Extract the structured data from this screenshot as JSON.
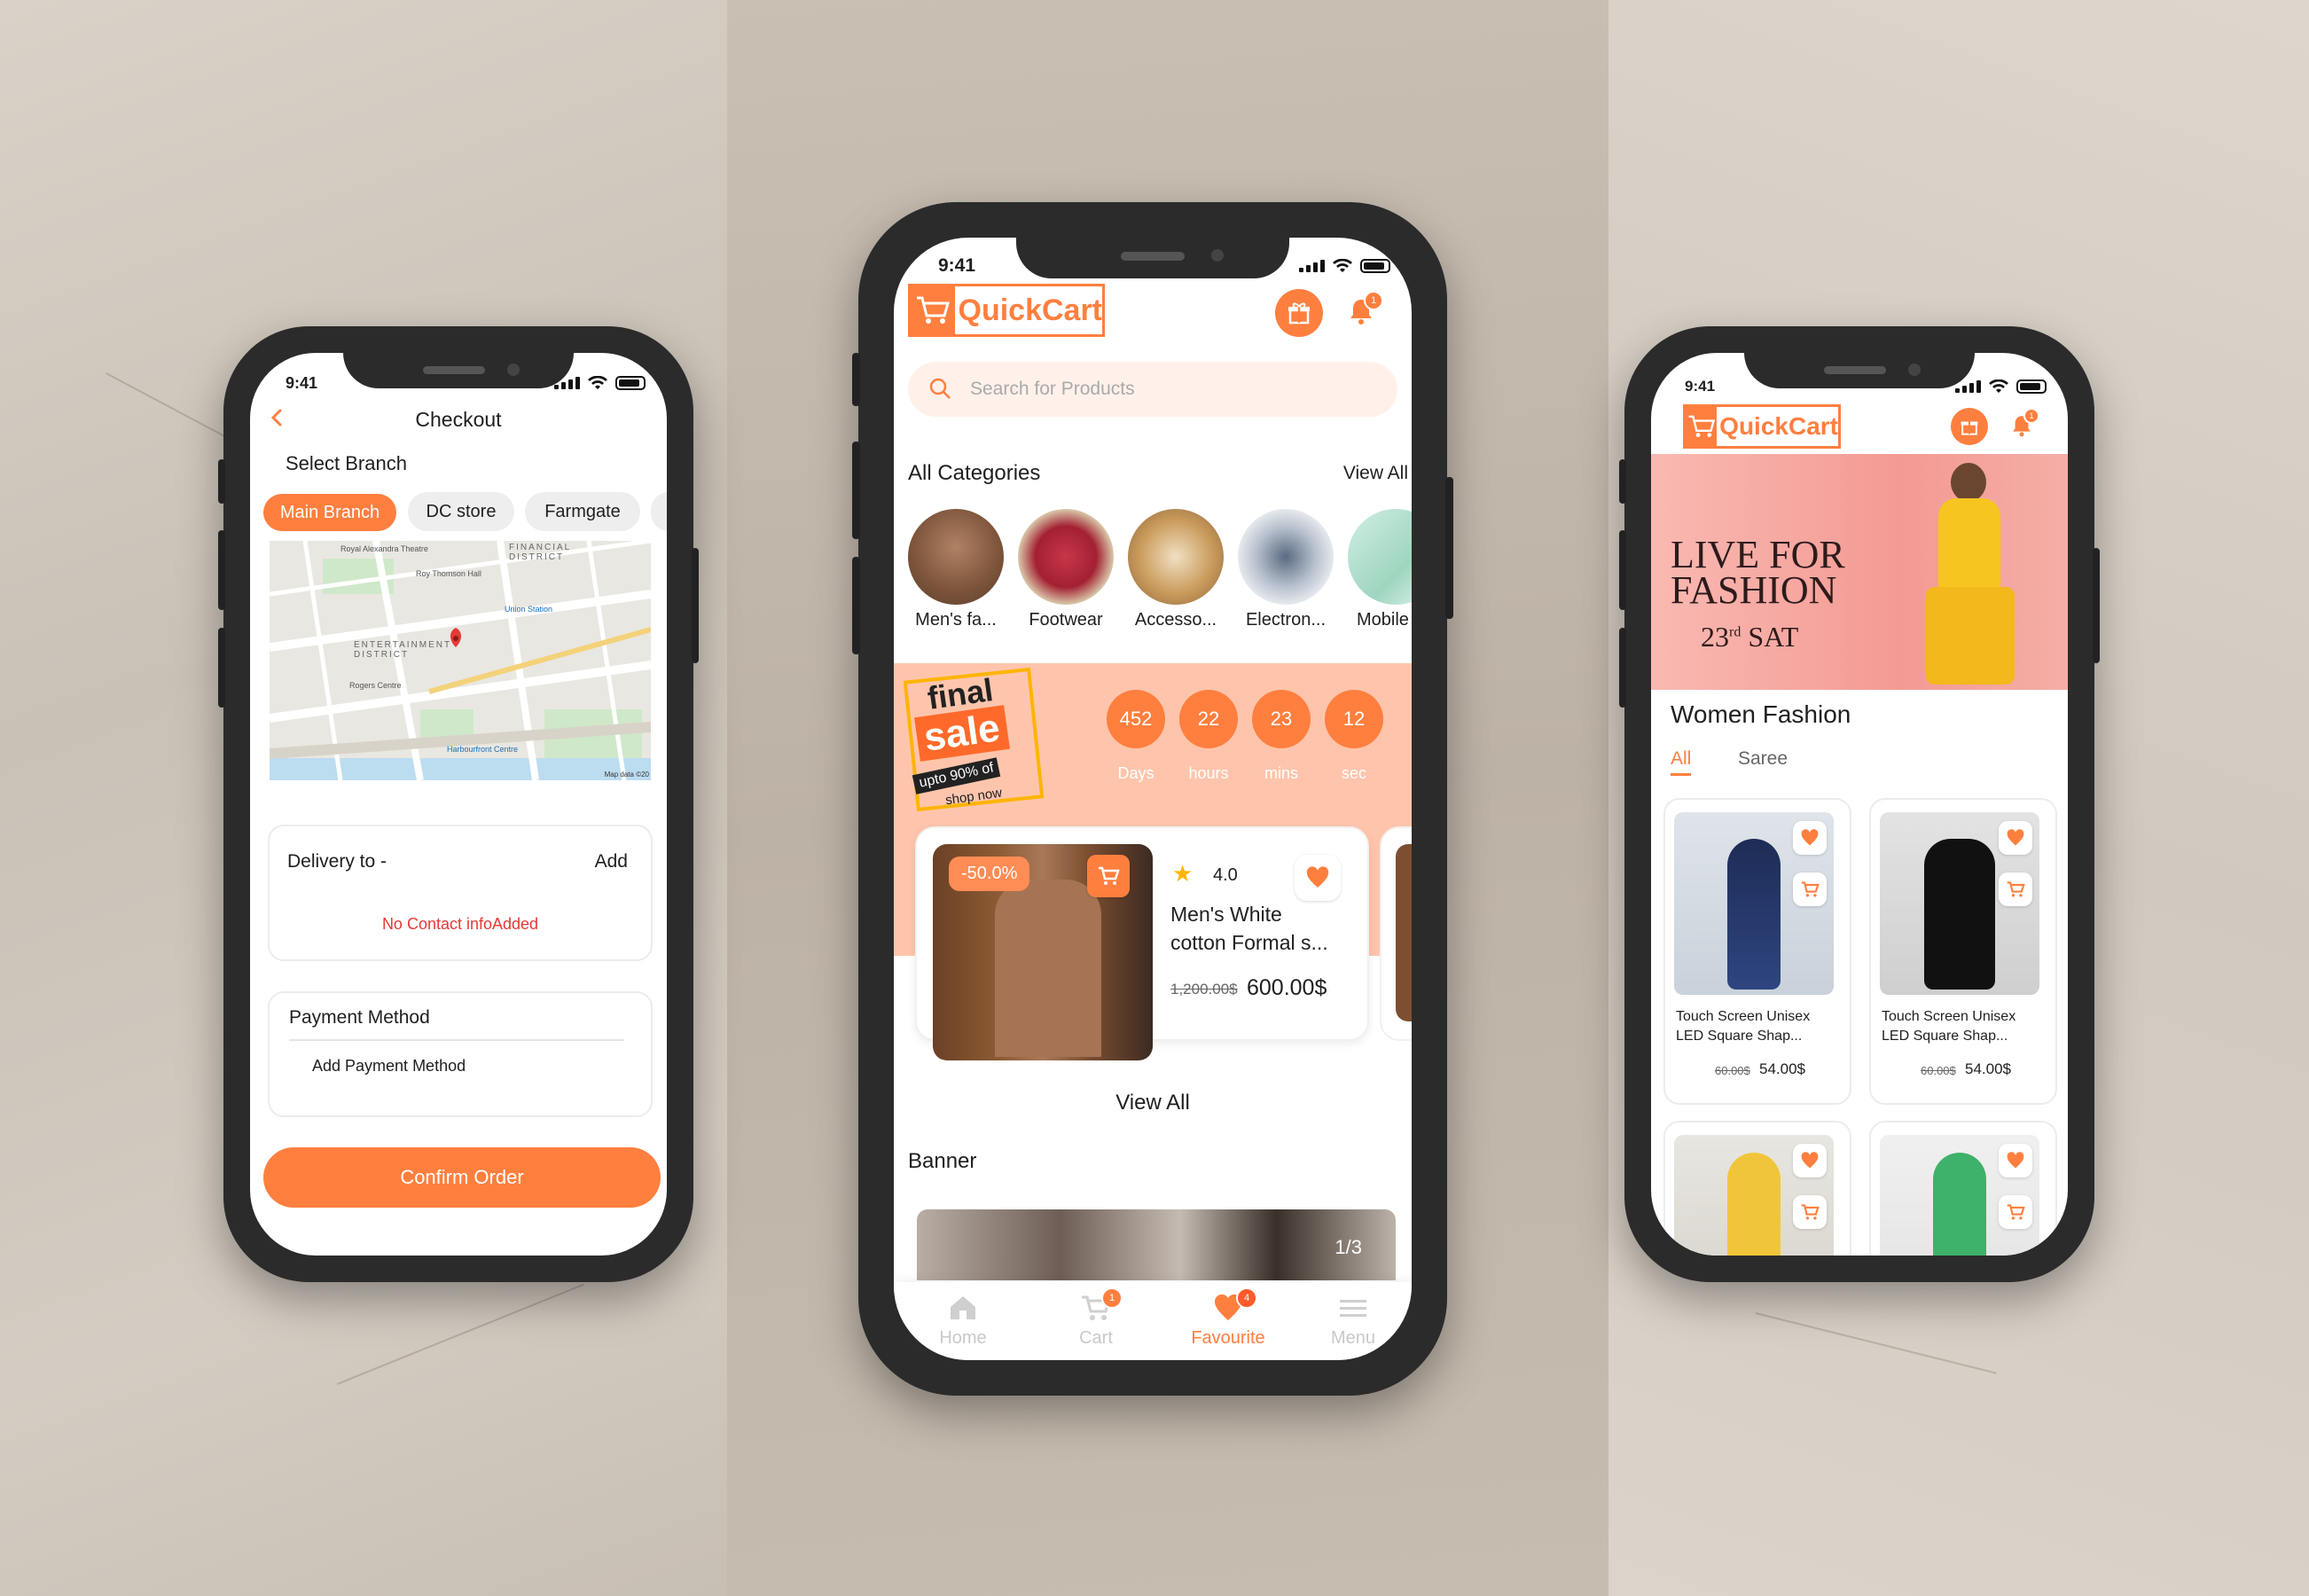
{
  "status": {
    "time": "9:41"
  },
  "checkout": {
    "title": "Checkout",
    "select_branch": "Select Branch",
    "branches": [
      "Main Branch",
      "DC store",
      "Farmgate"
    ],
    "map_labels": {
      "theatre": "Royal Alexandra Theatre",
      "financial": "FINANCIAL DISTRICT",
      "entertainment": "ENTERTAINMENT DISTRICT",
      "rogers": "Rogers Centre",
      "union": "Union Station",
      "roy": "Roy Thomson Hall",
      "harbourfront": "Harbourfront Centre",
      "map_data": "Map data ©20"
    },
    "delivery_label": "Delivery to -",
    "add_label": "Add",
    "no_contact": "No Contact infoAdded",
    "payment_title": "Payment Method",
    "add_payment": "Add Payment Method",
    "confirm": "Confirm Order"
  },
  "home": {
    "logo": "QuickCart",
    "bell_badge": "1",
    "search_placeholder": "Search for Products",
    "all_categories": "All Categories",
    "view_all": "View All",
    "categories": [
      "Men's fa...",
      "Footwear",
      "Accesso...",
      "Electron...",
      "Mobile"
    ],
    "sale": {
      "line1": "final",
      "line2": "sale",
      "line3": "upto 90% of",
      "line4": "shop now"
    },
    "countdown": [
      {
        "value": "452",
        "unit": "Days"
      },
      {
        "value": "22",
        "unit": "hours"
      },
      {
        "value": "23",
        "unit": "mins"
      },
      {
        "value": "12",
        "unit": "sec"
      }
    ],
    "product": {
      "discount": "-50.0%",
      "rating": "4.0",
      "name_line1": "Men's White",
      "name_line2": "cotton Formal s...",
      "old_price": "1,200.00$",
      "price": "600.00$"
    },
    "view_all_center": "View All",
    "banner_title": "Banner",
    "banner_counter": "1/3",
    "nav": [
      {
        "label": "Home",
        "badge": ""
      },
      {
        "label": "Cart",
        "badge": "1"
      },
      {
        "label": "Favourite",
        "badge": "4"
      },
      {
        "label": "Menu",
        "badge": ""
      }
    ]
  },
  "fashion": {
    "logo": "QuickCart",
    "banner": {
      "line1": "LIVE FOR",
      "line2": "FASHION",
      "date": "23",
      "sup": "rd",
      "day": "SAT"
    },
    "title": "Women Fashion",
    "tabs": [
      "All",
      "Saree"
    ],
    "products": [
      {
        "name1": "Touch Screen Unisex",
        "name2": "LED Square Shap...",
        "old": "60.00$",
        "price": "54.00$"
      },
      {
        "name1": "Touch Screen Unisex",
        "name2": "LED Square Shap...",
        "old": "60.00$",
        "price": "54.00$"
      }
    ]
  },
  "colors": {
    "accent": "#ff7f3f",
    "error": "#e53935"
  }
}
